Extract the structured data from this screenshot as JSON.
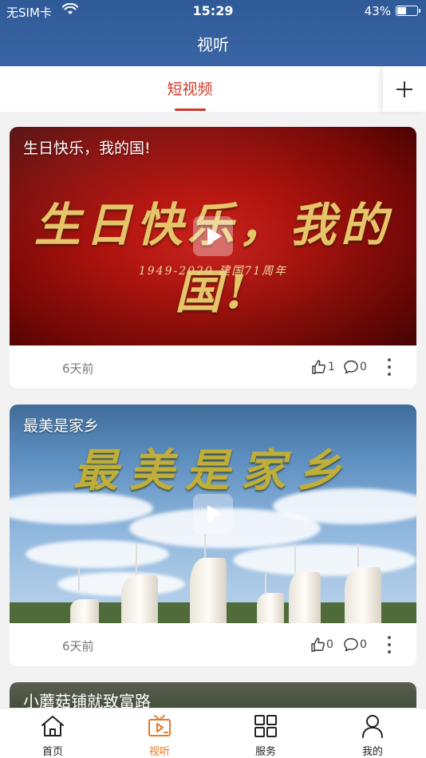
{
  "status_bar": {
    "carrier": "无SIM卡",
    "time": "15:29",
    "battery": "43%",
    "battery_level": 0.43
  },
  "header": {
    "title": "视听"
  },
  "tabs": {
    "active": "短视频"
  },
  "colors": {
    "header": "#3a65a4",
    "accent": "#d0382a",
    "nav_active": "#e07a2c"
  },
  "cards": [
    {
      "caption": "生日快乐，我的国!",
      "overlay_title": "生日快乐，我的国!",
      "overlay_subtitle": "1949-2020 建国71周年",
      "time_ago": "6天前",
      "likes": "1",
      "comments": "0"
    },
    {
      "caption": "最美是家乡",
      "overlay_title": "最美是家乡",
      "time_ago": "6天前",
      "likes": "0",
      "comments": "0"
    },
    {
      "caption": "小蘑菇铺就致富路"
    }
  ],
  "bottom_nav": [
    {
      "label": "首页",
      "icon": "home-icon"
    },
    {
      "label": "视听",
      "icon": "video-icon",
      "active": true
    },
    {
      "label": "服务",
      "icon": "grid-icon"
    },
    {
      "label": "我的",
      "icon": "user-icon"
    }
  ]
}
